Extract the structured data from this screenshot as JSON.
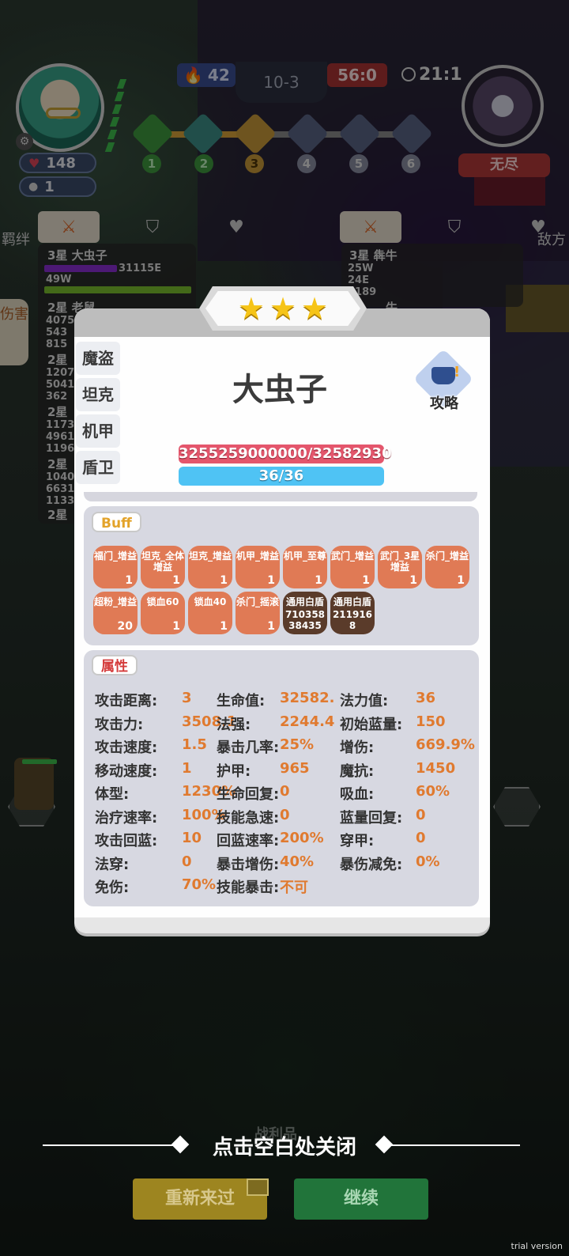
{
  "hud": {
    "fire_count": "42",
    "stage": "10-3",
    "score": "56:0",
    "timer": "21:1",
    "hp": "148",
    "coins": "1",
    "enemy_label": "无尽",
    "waves": [
      "1",
      "2",
      "3",
      "4",
      "5",
      "6"
    ]
  },
  "left_panel": {
    "side_tab_top": "羁绊",
    "side_tab_active": "伤害",
    "units": [
      {
        "name": "3星 大虫子",
        "value1": "31115E",
        "value2": "49W",
        "value3": "6..."
      },
      {
        "name": "2星 老鼠",
        "nums": "4075\n543\n815"
      },
      {
        "name": "2星",
        "nums": "1207\n5041\n362"
      },
      {
        "name": "2星",
        "nums": "1173\n4961\n1196"
      },
      {
        "name": "2星",
        "nums": "1040\n6631\n1133"
      },
      {
        "name": "2星"
      }
    ]
  },
  "right_panel": {
    "side_tab": "敌方",
    "unit_name": "3星 犇牛",
    "nums": "25W\n24E\n2189",
    "unit2": "牛"
  },
  "modal": {
    "hero_name": "大虫子",
    "strategy_label": "攻略",
    "hp_text": "3255259000000/32582930",
    "mp_text": "36/36",
    "class_tabs": [
      "魔盗",
      "坦克",
      "机甲",
      "盾卫",
      "..."
    ],
    "buff_label": "Buff",
    "attr_label": "属性",
    "buffs": [
      {
        "name": "福门_增益",
        "count": "1"
      },
      {
        "name": "坦克_全体增益",
        "count": "1"
      },
      {
        "name": "坦克_增益",
        "count": "1"
      },
      {
        "name": "机甲_增益",
        "count": "1"
      },
      {
        "name": "机甲_至尊",
        "count": "1"
      },
      {
        "name": "武门_增益",
        "count": "1"
      },
      {
        "name": "武门_3星增益",
        "count": "1"
      },
      {
        "name": "杀门_增益",
        "count": "1"
      },
      {
        "name": "超粉_增益",
        "count": "20"
      },
      {
        "name": "锁血60",
        "count": "1"
      },
      {
        "name": "锁血40",
        "count": "1"
      },
      {
        "name": "杀门_摇滚",
        "count": "1"
      },
      {
        "name": "通用白盾",
        "count": "710358\n38435"
      },
      {
        "name": "通用白盾",
        "count": "211916\n8"
      }
    ],
    "attributes": [
      {
        "label": "攻击距离:",
        "value": "3"
      },
      {
        "label": "生命值:",
        "value": "32582."
      },
      {
        "label": "法力值:",
        "value": "36"
      },
      {
        "label": "攻击力:",
        "value": "3508.1"
      },
      {
        "label": "法强:",
        "value": "2244.4"
      },
      {
        "label": "初始蓝量:",
        "value": "150"
      },
      {
        "label": "攻击速度:",
        "value": "1.5"
      },
      {
        "label": "暴击几率:",
        "value": "25%"
      },
      {
        "label": "增伤:",
        "value": "669.9%"
      },
      {
        "label": "移动速度:",
        "value": "1"
      },
      {
        "label": "护甲:",
        "value": "965"
      },
      {
        "label": "魔抗:",
        "value": "1450"
      },
      {
        "label": "体型:",
        "value": "1230%"
      },
      {
        "label": "生命回复:",
        "value": "0"
      },
      {
        "label": "吸血:",
        "value": "60%"
      },
      {
        "label": "治疗速率:",
        "value": "100%"
      },
      {
        "label": "技能急速:",
        "value": "0"
      },
      {
        "label": "蓝量回复:",
        "value": "0"
      },
      {
        "label": "攻击回蓝:",
        "value": "10"
      },
      {
        "label": "回蓝速率:",
        "value": "200%"
      },
      {
        "label": "穿甲:",
        "value": "0"
      },
      {
        "label": "法穿:",
        "value": "0"
      },
      {
        "label": "暴击增伤:",
        "value": "40%"
      },
      {
        "label": "暴伤减免:",
        "value": "0%"
      },
      {
        "label": "免伤:",
        "value": "70%"
      },
      {
        "label": "技能暴击:",
        "value": "不可"
      }
    ]
  },
  "footer": {
    "close_hint": "点击空白处关闭",
    "loot_label": "战利品",
    "retry_label": "重新来过",
    "continue_label": "继续",
    "trial_text": "trial version"
  },
  "colors": {
    "accent_orange": "#e07a2f",
    "buff_tile": "#e07a55",
    "hp_bar": "#e4566c",
    "mp_bar": "#4fc3f4",
    "star": "#f6c417"
  }
}
